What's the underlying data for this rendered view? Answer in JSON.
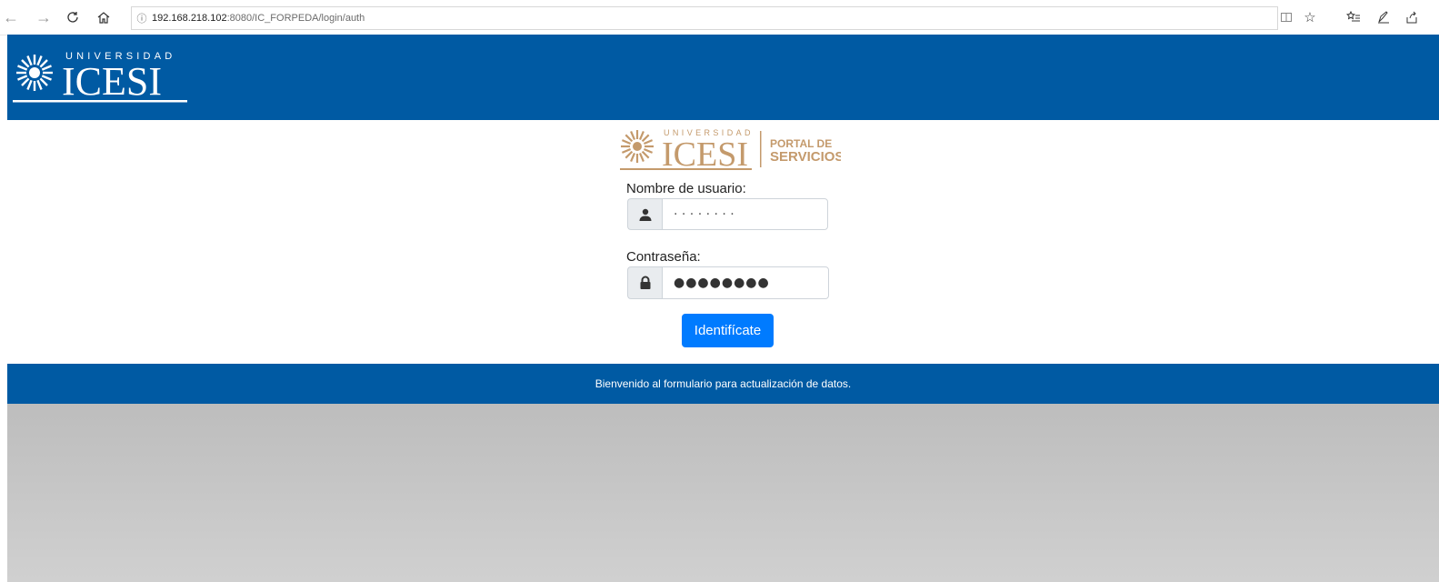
{
  "browser": {
    "address_info": "ⓘ",
    "address_host": "192.168.218.102",
    "address_path": ":8080/IC_FORPEDA/login/auth"
  },
  "header": {
    "logo_top": "UNIVERSIDAD",
    "logo_main": "ICESI"
  },
  "portal_logo": {
    "top": "UNIVERSIDAD",
    "main": "ICESI",
    "line1": "PORTAL DE",
    "line2": "SERVICIOS",
    "color": "#c49a6c"
  },
  "login": {
    "username_label": "Nombre de usuario:",
    "username_value": "· · · · · · · ·",
    "password_label": "Contraseña:",
    "password_value": "●●●●●●●●",
    "submit_label": "Identifícate"
  },
  "footer": {
    "text": "Bienvenido al formulario para actualización de datos."
  },
  "colors": {
    "brand_blue": "#005aa3",
    "button_blue": "#007bff"
  }
}
